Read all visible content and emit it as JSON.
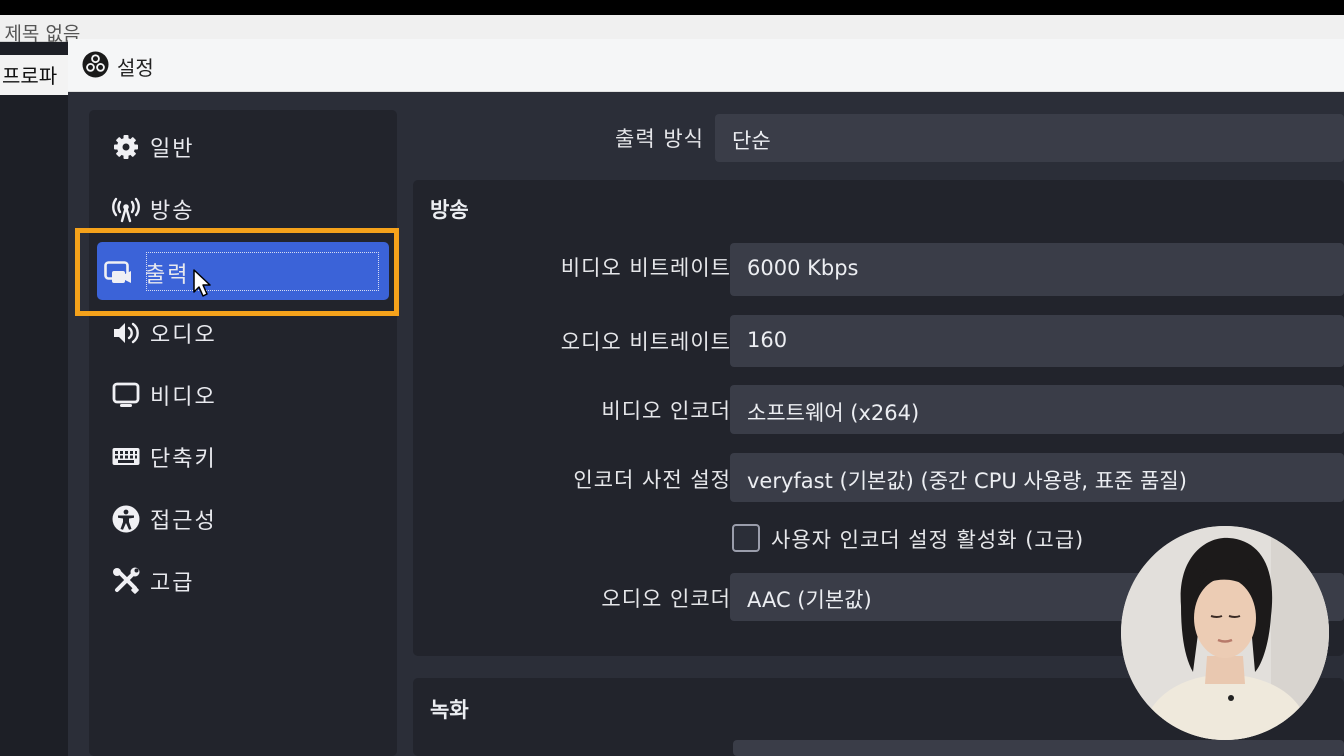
{
  "background_app": {
    "title": ": 제목 없음",
    "menu_item": "프로파"
  },
  "dialog": {
    "title": "설정",
    "logo_icon": "obs-logo-icon"
  },
  "sidebar": {
    "items": [
      {
        "label": "일반",
        "icon": "gear-icon"
      },
      {
        "label": "방송",
        "icon": "antenna-icon"
      },
      {
        "label": "출력",
        "icon": "output-icon",
        "selected": true
      },
      {
        "label": "오디오",
        "icon": "speaker-icon"
      },
      {
        "label": "비디오",
        "icon": "monitor-icon"
      },
      {
        "label": "단축키",
        "icon": "keyboard-icon"
      },
      {
        "label": "접근성",
        "icon": "accessibility-icon"
      },
      {
        "label": "고급",
        "icon": "tools-icon"
      }
    ]
  },
  "output": {
    "mode_label": "출력 방식",
    "mode_value": "단순",
    "streaming": {
      "title": "방송",
      "video_bitrate_label": "비디오 비트레이트",
      "video_bitrate_value": "6000 Kbps",
      "audio_bitrate_label": "오디오 비트레이트",
      "audio_bitrate_value": "160",
      "video_encoder_label": "비디오 인코더",
      "video_encoder_value": "소프트웨어 (x264)",
      "encoder_preset_label": "인코더 사전 설정",
      "encoder_preset_value": "veryfast (기본값) (중간 CPU 사용량, 표준 품질)",
      "custom_encoder_checkbox_label": "사용자 인코더 설정 활성화 (고급)",
      "custom_encoder_checked": false,
      "audio_encoder_label": "오디오 인코더",
      "audio_encoder_value": "AAC (기본값)"
    },
    "recording": {
      "title": "녹화"
    }
  },
  "colors": {
    "highlight": "#f5a21b",
    "selected": "#3b63d8",
    "dialog_bg": "#2b2e38",
    "panel_bg": "#22242c",
    "field_bg": "#3a3d48"
  }
}
